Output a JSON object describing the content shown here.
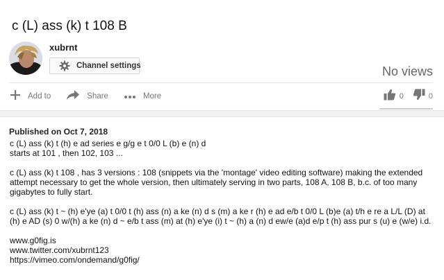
{
  "video": {
    "title": "c (L) ass (k) t 108 B",
    "views": "No views"
  },
  "channel": {
    "name": "xubrnt",
    "settings_label": "Channel settings"
  },
  "actions": {
    "add_to": "Add to",
    "share": "Share",
    "more": "More"
  },
  "rating": {
    "likes": "0",
    "dislikes": "0"
  },
  "description": {
    "published": "Published on Oct 7, 2018",
    "paragraphs": [
      "c (L) ass (k) t (h) e ad series e g/g e t 0/0 L (b) e (n) d\nstarts at 101 , then 102, 103 ...",
      "c (L) ass (k) t 108 , has 3 versions : 108 (snippets via the 'montage' video editing software) making the extended attempt necessary to get the whole version, then ultimately serving in two parts, 108 A, 108 B, b.c. of too many gigabytes to fully start.",
      "c (L) ass (k) t ~ (h) e'ye (a) t 0/0 t (h) ass (n) a ke (n) d s (m) a ke r (h) e ad e/b t 0/0 L (b)e (a) t/h e re a L/L (D) at (h) e AD (s) 0 w/(h) a ke (n) d ~ e/b t ass (m) at (h) e'ye (i) t ~ (h) a (n) d ew/e (a)d e/p t (h) ass pur s (u) e (w/e) i.d."
    ],
    "links": [
      "www.g0fig.is",
      "www.twitter.com/xubrnt123",
      "https://vimeo.com/ondemand/g0fig/"
    ]
  },
  "icons": {
    "add": "plus-icon",
    "share": "share-arrow-icon",
    "more": "more-dots-icon",
    "settings": "gear-icon",
    "like": "thumbs-up-icon",
    "dislike": "thumbs-down-icon"
  },
  "colors": {
    "icon_gray": "#767676",
    "text_dark": "#111111",
    "views_gray": "#666666"
  }
}
